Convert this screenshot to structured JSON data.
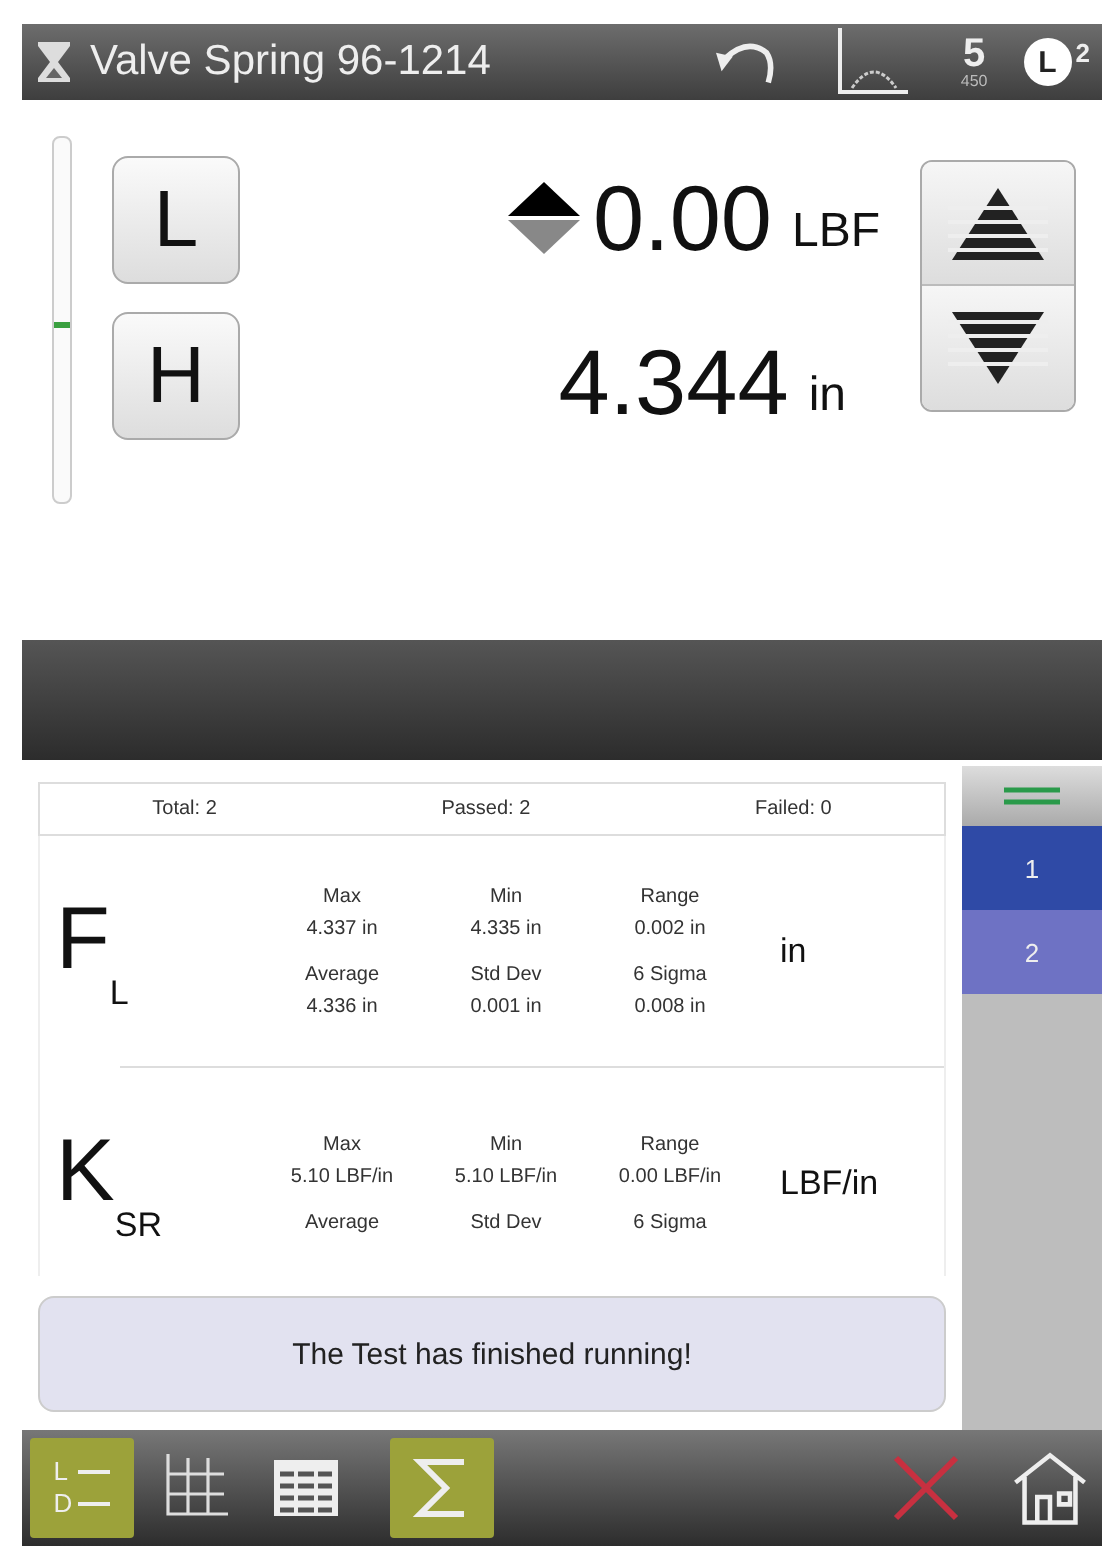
{
  "title_bar": {
    "title": "Valve Spring 96-1214",
    "speed": "5",
    "speed_sub": "450",
    "load_mode": "L",
    "load_mode_sup": "2"
  },
  "position_slider": {
    "level": 0.48
  },
  "limit_buttons": [
    "L",
    "H"
  ],
  "readings": [
    {
      "kind": "force",
      "value": "0.00",
      "unit": "LBF"
    },
    {
      "kind": "length",
      "value": "4.344",
      "unit": "in"
    }
  ],
  "summary": {
    "total": "Total: 2",
    "passed": "Passed: 2",
    "failed": "Failed: 0"
  },
  "stat_groups": [
    {
      "symbol": "F",
      "subscript": "L",
      "unit": "in",
      "stats": [
        {
          "label": "Max",
          "value": "4.337 in"
        },
        {
          "label": "Min",
          "value": "4.335 in"
        },
        {
          "label": "Range",
          "value": "0.002 in"
        },
        {
          "label": "Average",
          "value": "4.336 in"
        },
        {
          "label": "Std Dev",
          "value": "0.001 in"
        },
        {
          "label": "6 Sigma",
          "value": "0.008 in"
        }
      ]
    },
    {
      "symbol": "K",
      "subscript": "SR",
      "unit": "LBF/in",
      "stats": [
        {
          "label": "Max",
          "value": "5.10 LBF/in"
        },
        {
          "label": "Min",
          "value": "5.10 LBF/in"
        },
        {
          "label": "Range",
          "value": "0.00 LBF/in"
        },
        {
          "label": "Average"
        },
        {
          "label": "Std Dev"
        },
        {
          "label": "6 Sigma"
        }
      ]
    }
  ],
  "message": "The Test has finished running!",
  "tests": [
    {
      "label": "1",
      "selected": true
    },
    {
      "label": "2",
      "selected": false
    }
  ],
  "toolbar": [
    {
      "kind": "limits",
      "letters": [
        "L",
        "D"
      ],
      "selected": true
    },
    {
      "kind": "graph",
      "selected": false
    },
    {
      "kind": "table",
      "selected": false
    },
    {
      "kind": "sigma",
      "selected": true
    }
  ]
}
